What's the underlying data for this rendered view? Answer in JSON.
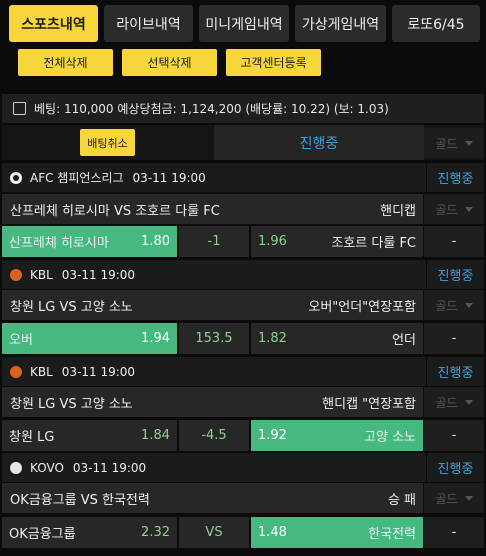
{
  "tabs": [
    {
      "label": "스포츠내역",
      "active": true
    },
    {
      "label": "라이브내역",
      "active": false
    },
    {
      "label": "미니게임내역",
      "active": false
    },
    {
      "label": "가상게임내역",
      "active": false
    },
    {
      "label": "로또6/45",
      "active": false
    }
  ],
  "actions": {
    "delete_all": "전체삭제",
    "delete_selected": "선택삭제",
    "register_support": "고객센터등록"
  },
  "summary": {
    "text": "베팅: 110,000 예상당첨금: 1,124,200 (배당률: 10.22) (보: 1.03)"
  },
  "status_header": {
    "cancel_label": "배팅취소",
    "title": "진행중",
    "gold_label": "골드"
  },
  "colors": {
    "accent_yellow": "#f7d63c",
    "selected_green": "#45b97f",
    "status_blue": "#3aa3e0",
    "odds_green": "#8fd08f"
  },
  "bets": [
    {
      "league_icon": "soccer-ball-icon",
      "league": "AFC 챔피언스리그",
      "date": "03-11 19:00",
      "state": "진행중",
      "match_title": "산프레체 히로시마 VS 조호르 다룰 FC",
      "bet_type": "핸디캡",
      "gold_label": "골드",
      "home_name": "산프레체 히로시마",
      "home_odds": "1.80",
      "middle": "-1",
      "away_odds": "1.96",
      "away_name": "조호르 다룰 FC",
      "result": "-",
      "selected": "home"
    },
    {
      "league_icon": "basketball-icon",
      "league": "KBL",
      "date": "03-11 19:00",
      "state": "진행중",
      "match_title": "창원 LG VS 고양 소노",
      "bet_type": "오버\"언더\"연장포함",
      "gold_label": "골드",
      "home_name": "오버",
      "home_odds": "1.94",
      "middle": "153.5",
      "away_odds": "1.82",
      "away_name": "언더",
      "result": "-",
      "selected": "home"
    },
    {
      "league_icon": "basketball-icon",
      "league": "KBL",
      "date": "03-11 19:00",
      "state": "진행중",
      "match_title": "창원 LG VS 고양 소노",
      "bet_type": "핸디캡 \"연장포함",
      "gold_label": "골드",
      "home_name": "창원 LG",
      "home_odds": "1.84",
      "middle": "-4.5",
      "away_odds": "1.92",
      "away_name": "고양 소노",
      "result": "-",
      "selected": "away"
    },
    {
      "league_icon": "volleyball-icon",
      "league": "KOVO",
      "date": "03-11 19:00",
      "state": "진행중",
      "match_title": "OK금융그룹 VS 한국전력",
      "bet_type": "승 패",
      "gold_label": "골드",
      "home_name": "OK금융그룹",
      "home_odds": "2.32",
      "middle": "VS",
      "away_odds": "1.48",
      "away_name": "한국전력",
      "result": "-",
      "selected": "away"
    }
  ]
}
